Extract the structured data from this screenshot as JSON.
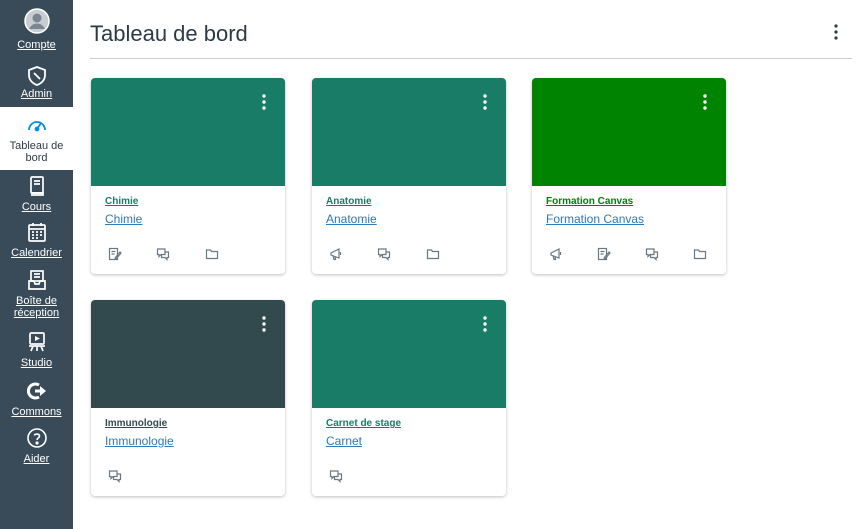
{
  "sidebar": {
    "items": [
      {
        "label": "Compte",
        "icon": "account-icon"
      },
      {
        "label": "Admin",
        "icon": "admin-shield-icon"
      },
      {
        "label": "Tableau de bord",
        "icon": "dashboard-gauge-icon"
      },
      {
        "label": "Cours",
        "icon": "courses-book-icon"
      },
      {
        "label": "Calendrier",
        "icon": "calendar-icon"
      },
      {
        "label": "Boîte de réception",
        "icon": "inbox-icon"
      },
      {
        "label": "Studio",
        "icon": "studio-icon"
      },
      {
        "label": "Commons",
        "icon": "commons-icon"
      },
      {
        "label": "Aider",
        "icon": "help-icon"
      }
    ],
    "active_index": 2,
    "background": "#394b58",
    "active_color": "#008ee2"
  },
  "header": {
    "title": "Tableau de bord"
  },
  "cards": [
    {
      "code": "Chimie",
      "name": "Chimie",
      "color": "#197c66",
      "code_color": "#197c66",
      "actions": [
        "assignments-icon",
        "discussions-icon",
        "files-icon"
      ]
    },
    {
      "code": "Anatomie",
      "name": "Anatomie",
      "color": "#197c66",
      "code_color": "#197c66",
      "actions": [
        "announcements-icon",
        "discussions-icon",
        "files-icon"
      ]
    },
    {
      "code": "Formation Canvas",
      "name": "Formation Canvas",
      "color": "#008400",
      "code_color": "#008400",
      "actions": [
        "announcements-icon",
        "assignments-icon",
        "discussions-icon",
        "files-icon"
      ]
    },
    {
      "code": "Immunologie",
      "name": "Immunologie",
      "color": "#324a4d",
      "code_color": "#324a4d",
      "actions": [
        "discussions-icon"
      ]
    },
    {
      "code": "Carnet de stage",
      "name": "Carnet",
      "color": "#197c66",
      "code_color": "#197c66",
      "actions": [
        "discussions-icon"
      ]
    }
  ]
}
